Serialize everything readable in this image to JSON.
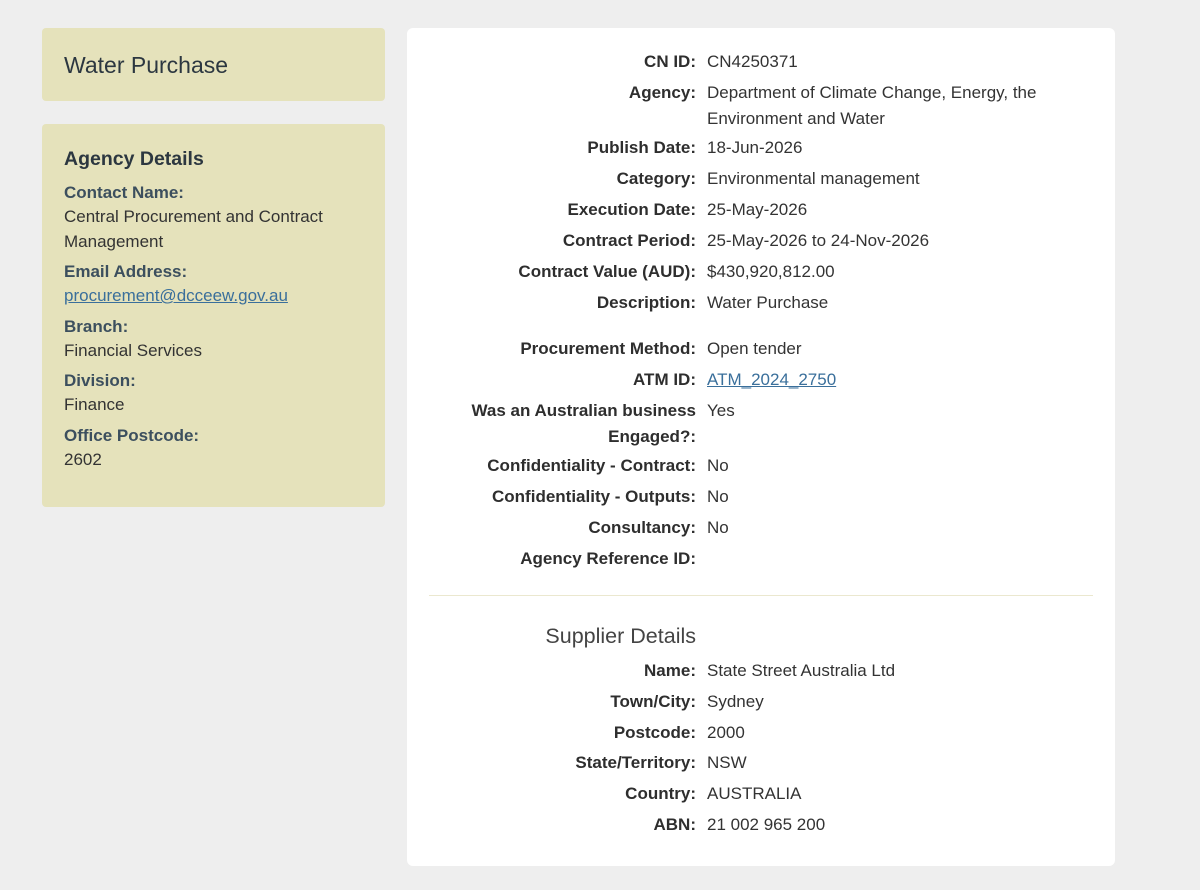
{
  "title": "Water Purchase",
  "agency_details": {
    "heading": "Agency Details",
    "contact_name_label": "Contact Name:",
    "contact_name": "Central Procurement and Contract Management",
    "email_label": "Email Address:",
    "email": "procurement@dcceew.gov.au",
    "branch_label": "Branch:",
    "branch": "Financial Services",
    "division_label": "Division:",
    "division": "Finance",
    "postcode_label": "Office Postcode:",
    "postcode": "2602"
  },
  "contract": {
    "cn_id_label": "CN ID:",
    "cn_id": "CN4250371",
    "agency_label": "Agency:",
    "agency": "Department of Climate Change, Energy, the Environment and Water",
    "publish_date_label": "Publish Date:",
    "publish_date": "18-Jun-2026",
    "category_label": "Category:",
    "category": "Environmental management",
    "execution_date_label": "Execution Date:",
    "execution_date": "25-May-2026",
    "contract_period_label": "Contract Period:",
    "contract_period": "25-May-2026 to 24-Nov-2026",
    "contract_value_label": "Contract Value (AUD):",
    "contract_value": "$430,920,812.00",
    "description_label": "Description:",
    "description": "Water Purchase",
    "procurement_method_label": "Procurement Method:",
    "procurement_method": "Open tender",
    "atm_id_label": "ATM ID:",
    "atm_id": "ATM_2024_2750",
    "australian_business_label": "Was an Australian business Engaged?:",
    "australian_business": "Yes",
    "conf_contract_label": "Confidentiality - Contract:",
    "conf_contract": "No",
    "conf_outputs_label": "Confidentiality - Outputs:",
    "conf_outputs": "No",
    "consultancy_label": "Consultancy:",
    "consultancy": "No",
    "agency_ref_label": "Agency Reference ID:",
    "agency_ref": ""
  },
  "supplier": {
    "heading": "Supplier Details",
    "name_label": "Name:",
    "name": "State Street Australia Ltd",
    "town_label": "Town/City:",
    "town": "Sydney",
    "postcode_label": "Postcode:",
    "postcode": "2000",
    "state_label": "State/Territory:",
    "state": "NSW",
    "country_label": "Country:",
    "country": "AUSTRALIA",
    "abn_label": "ABN:",
    "abn": "21 002 965 200"
  }
}
